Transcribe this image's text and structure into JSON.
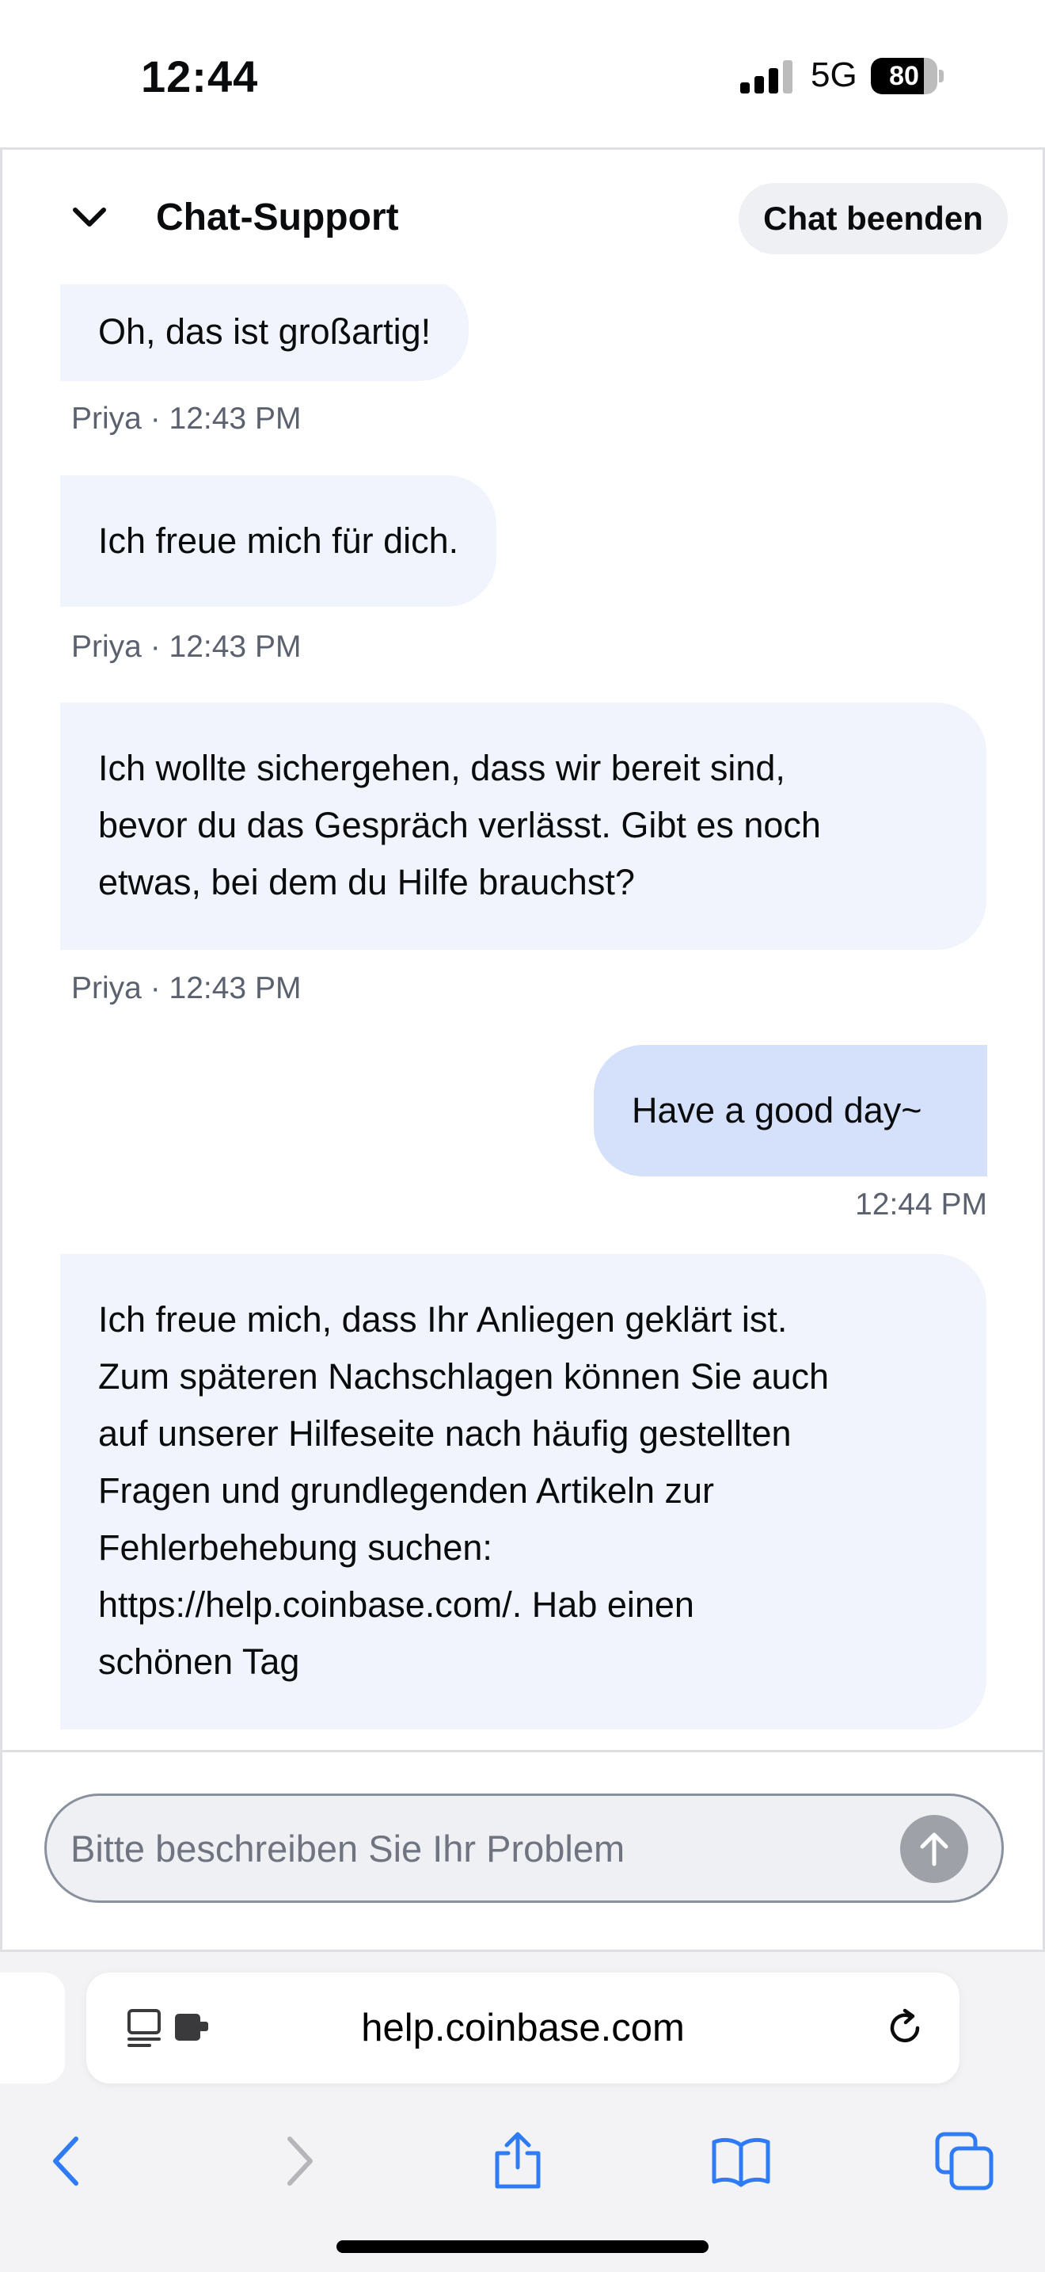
{
  "status_bar": {
    "time": "12:44",
    "network": "5G",
    "battery": "80",
    "battery_level": 0.8
  },
  "chat": {
    "title": "Chat-Support",
    "end_label": "Chat beenden",
    "messages": [
      {
        "sender": "agent",
        "text": "Oh, das ist großartig!",
        "meta": "Priya · 12:43 PM"
      },
      {
        "sender": "agent",
        "text": "Ich freue mich für dich.",
        "meta": "Priya · 12:43 PM"
      },
      {
        "sender": "agent",
        "lines": [
          "Ich wollte sichergehen, dass wir bereit sind,",
          "bevor du das Gespräch verlässt. Gibt es noch",
          "etwas, bei dem du Hilfe brauchst?"
        ],
        "meta": "Priya · 12:43 PM"
      },
      {
        "sender": "user",
        "text": "Have a good day~",
        "meta": "12:44 PM"
      },
      {
        "sender": "agent",
        "lines": [
          "Ich freue mich, dass Ihr Anliegen geklärt ist.",
          "Zum späteren Nachschlagen können Sie auch",
          "auf unserer Hilfeseite nach häufig gestellten",
          "Fragen und grundlegenden Artikeln zur",
          "Fehlerbehebung suchen:",
          "https://help.coinbase.com/. Hab einen",
          "schönen Tag"
        ]
      }
    ],
    "input": {
      "placeholder": "Bitte beschreiben Sie Ihr Problem",
      "value": ""
    }
  },
  "browser": {
    "url": "help.coinbase.com"
  },
  "icons": [
    "chevron-down-icon",
    "send-arrow-icon",
    "reader-icon",
    "extension-icon",
    "reload-icon",
    "back-icon",
    "forward-icon",
    "share-icon",
    "bookmarks-icon",
    "tabs-icon"
  ],
  "colors": {
    "agent_bubble": "#f1f4fd",
    "user_bubble": "#d5e0fa",
    "meta_text": "#5b616e",
    "safari_blue": "#2f7bf5",
    "send_button": "#9ea1a8"
  }
}
